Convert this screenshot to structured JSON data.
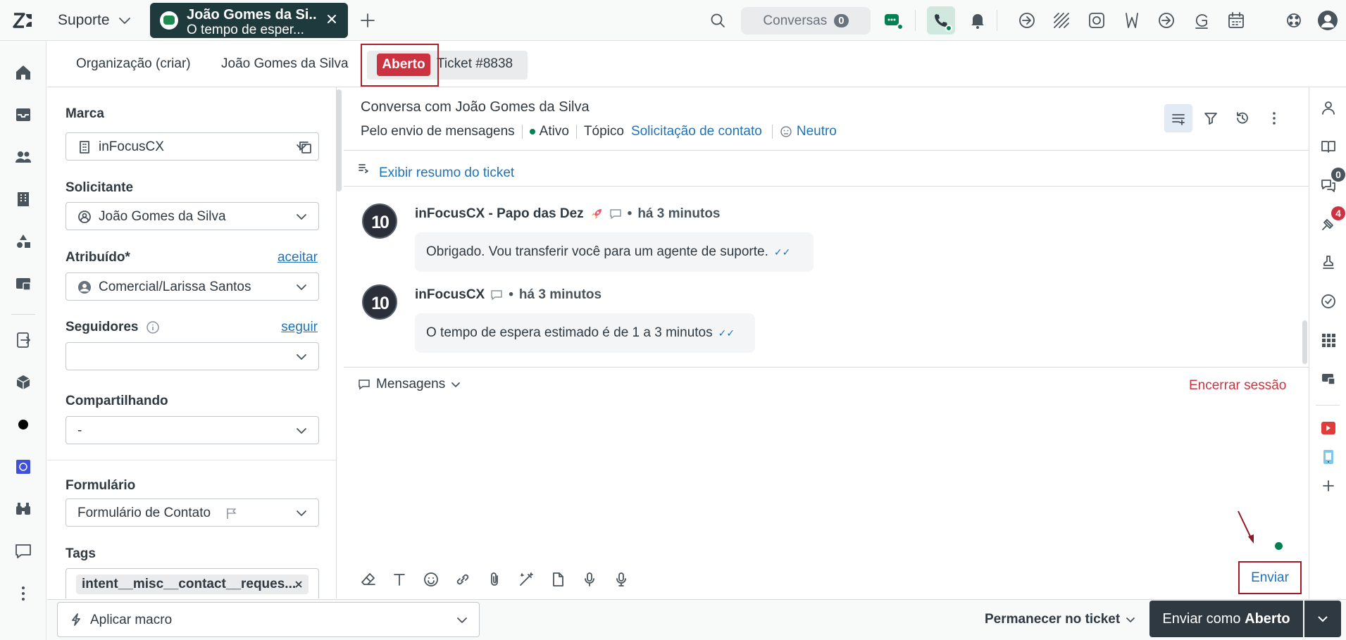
{
  "topbar": {
    "product": "Suporte",
    "active_tab": {
      "title": "João Gomes da Si...",
      "subtitle": "O tempo de esper..."
    },
    "conversations_label": "Conversas",
    "conversations_count": "0"
  },
  "breadcrumb": {
    "organization": "Organização (criar)",
    "requester": "João Gomes da Silva",
    "status": "Aberto",
    "ticket": "Ticket #8838"
  },
  "fields": {
    "brand_label": "Marca",
    "brand_value": "inFocusCX",
    "requester_label": "Solicitante",
    "requester_value": "João Gomes da Silva",
    "assignee_label": "Atribuído*",
    "assignee_action": "aceitar",
    "assignee_value": "Comercial/Larissa Santos",
    "followers_label": "Seguidores",
    "followers_action": "seguir",
    "followers_value": "",
    "sharing_label": "Compartilhando",
    "sharing_value": "-",
    "form_label": "Formulário",
    "form_value": "Formulário de Contato",
    "tags_label": "Tags",
    "tag_1": "intent__misc__contact__reques..."
  },
  "conversation": {
    "title": "Conversa com João Gomes da Silva",
    "channel": "Pelo envio de mensagens",
    "state": "Ativo",
    "topic_label": "Tópico",
    "topic_value": "Solicitação de contato",
    "sentiment": "Neutro",
    "summary_link": "Exibir resumo do ticket",
    "messages": [
      {
        "avatar": "10",
        "sender": "inFocusCX - Papo das Dez",
        "time": "há 3 minutos",
        "text": "Obrigado. Vou transferir você para um agente de suporte."
      },
      {
        "avatar": "10",
        "sender": "inFocusCX",
        "time": "há 3 minutos",
        "text": "O tempo de espera estimado é de 1 a 3 minutos"
      }
    ]
  },
  "composer": {
    "channel": "Mensagens",
    "end_session": "Encerrar sessão",
    "send": "Enviar"
  },
  "sidebar_badges": {
    "conversations": "0",
    "apps": "4"
  },
  "footer": {
    "macro_placeholder": "Aplicar macro",
    "stay": "Permanecer no ticket",
    "submit_prefix": "Enviar como ",
    "submit_status": "Aberto"
  },
  "colors": {
    "status_open": "#cc3340",
    "link": "#1f73b7",
    "active_green": "#038153",
    "tab_dark": "#1f3a3d"
  }
}
